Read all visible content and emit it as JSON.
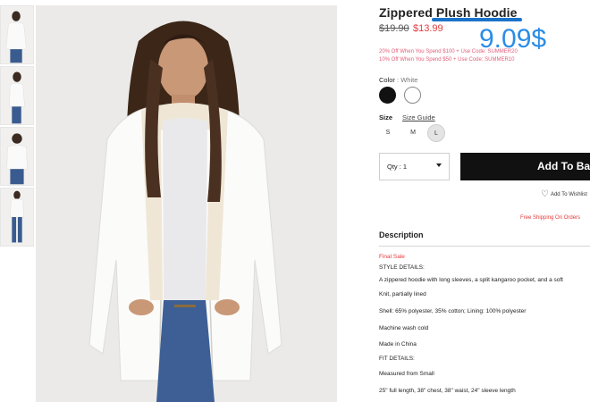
{
  "product": {
    "title": "Zippered Plush Hoodie",
    "price_original": "$19.90",
    "price_sale": "$13.99",
    "price_annotation": "9.09$",
    "promos": [
      "20% Off When You Spend $100 + Use Code: SUMMER20",
      "10% Off When You Spend $50 + Use Code: SUMMER10"
    ]
  },
  "color": {
    "label": "Color",
    "separator": ":",
    "selected": "White",
    "swatches": [
      {
        "name": "Black",
        "hex": "#111111"
      },
      {
        "name": "White",
        "hex": "#ffffff"
      }
    ]
  },
  "size": {
    "label": "Size",
    "guide": "Size Guide",
    "options": [
      "S",
      "M",
      "L"
    ],
    "selected": "L"
  },
  "purchase": {
    "qty_label": "Qty : 1",
    "add_button": "Add To Bag",
    "wishlist": "Add To Wishlist",
    "shipping": "Free Shipping On Orders"
  },
  "description": {
    "heading": "Description",
    "final_sale": "Final Sale",
    "lines": [
      "STYLE DETAILS:",
      "A zippered hoodie with long sleeves, a split kangaroo pocket, and a soft",
      "Knit, partially lined",
      "Shell: 65% polyester, 35% cotton; Lining: 100% polyester",
      "Machine wash cold",
      "Made in China",
      "FIT DETAILS:",
      "Measured from Small",
      "25\" full length, 38\" chest, 38\" waist, 24\" sleeve length"
    ]
  },
  "colors": {
    "accent_blue": "#1a73c9",
    "sale_red": "#e23b3b",
    "promo_pink": "#e0607a",
    "button_black": "#111111"
  }
}
